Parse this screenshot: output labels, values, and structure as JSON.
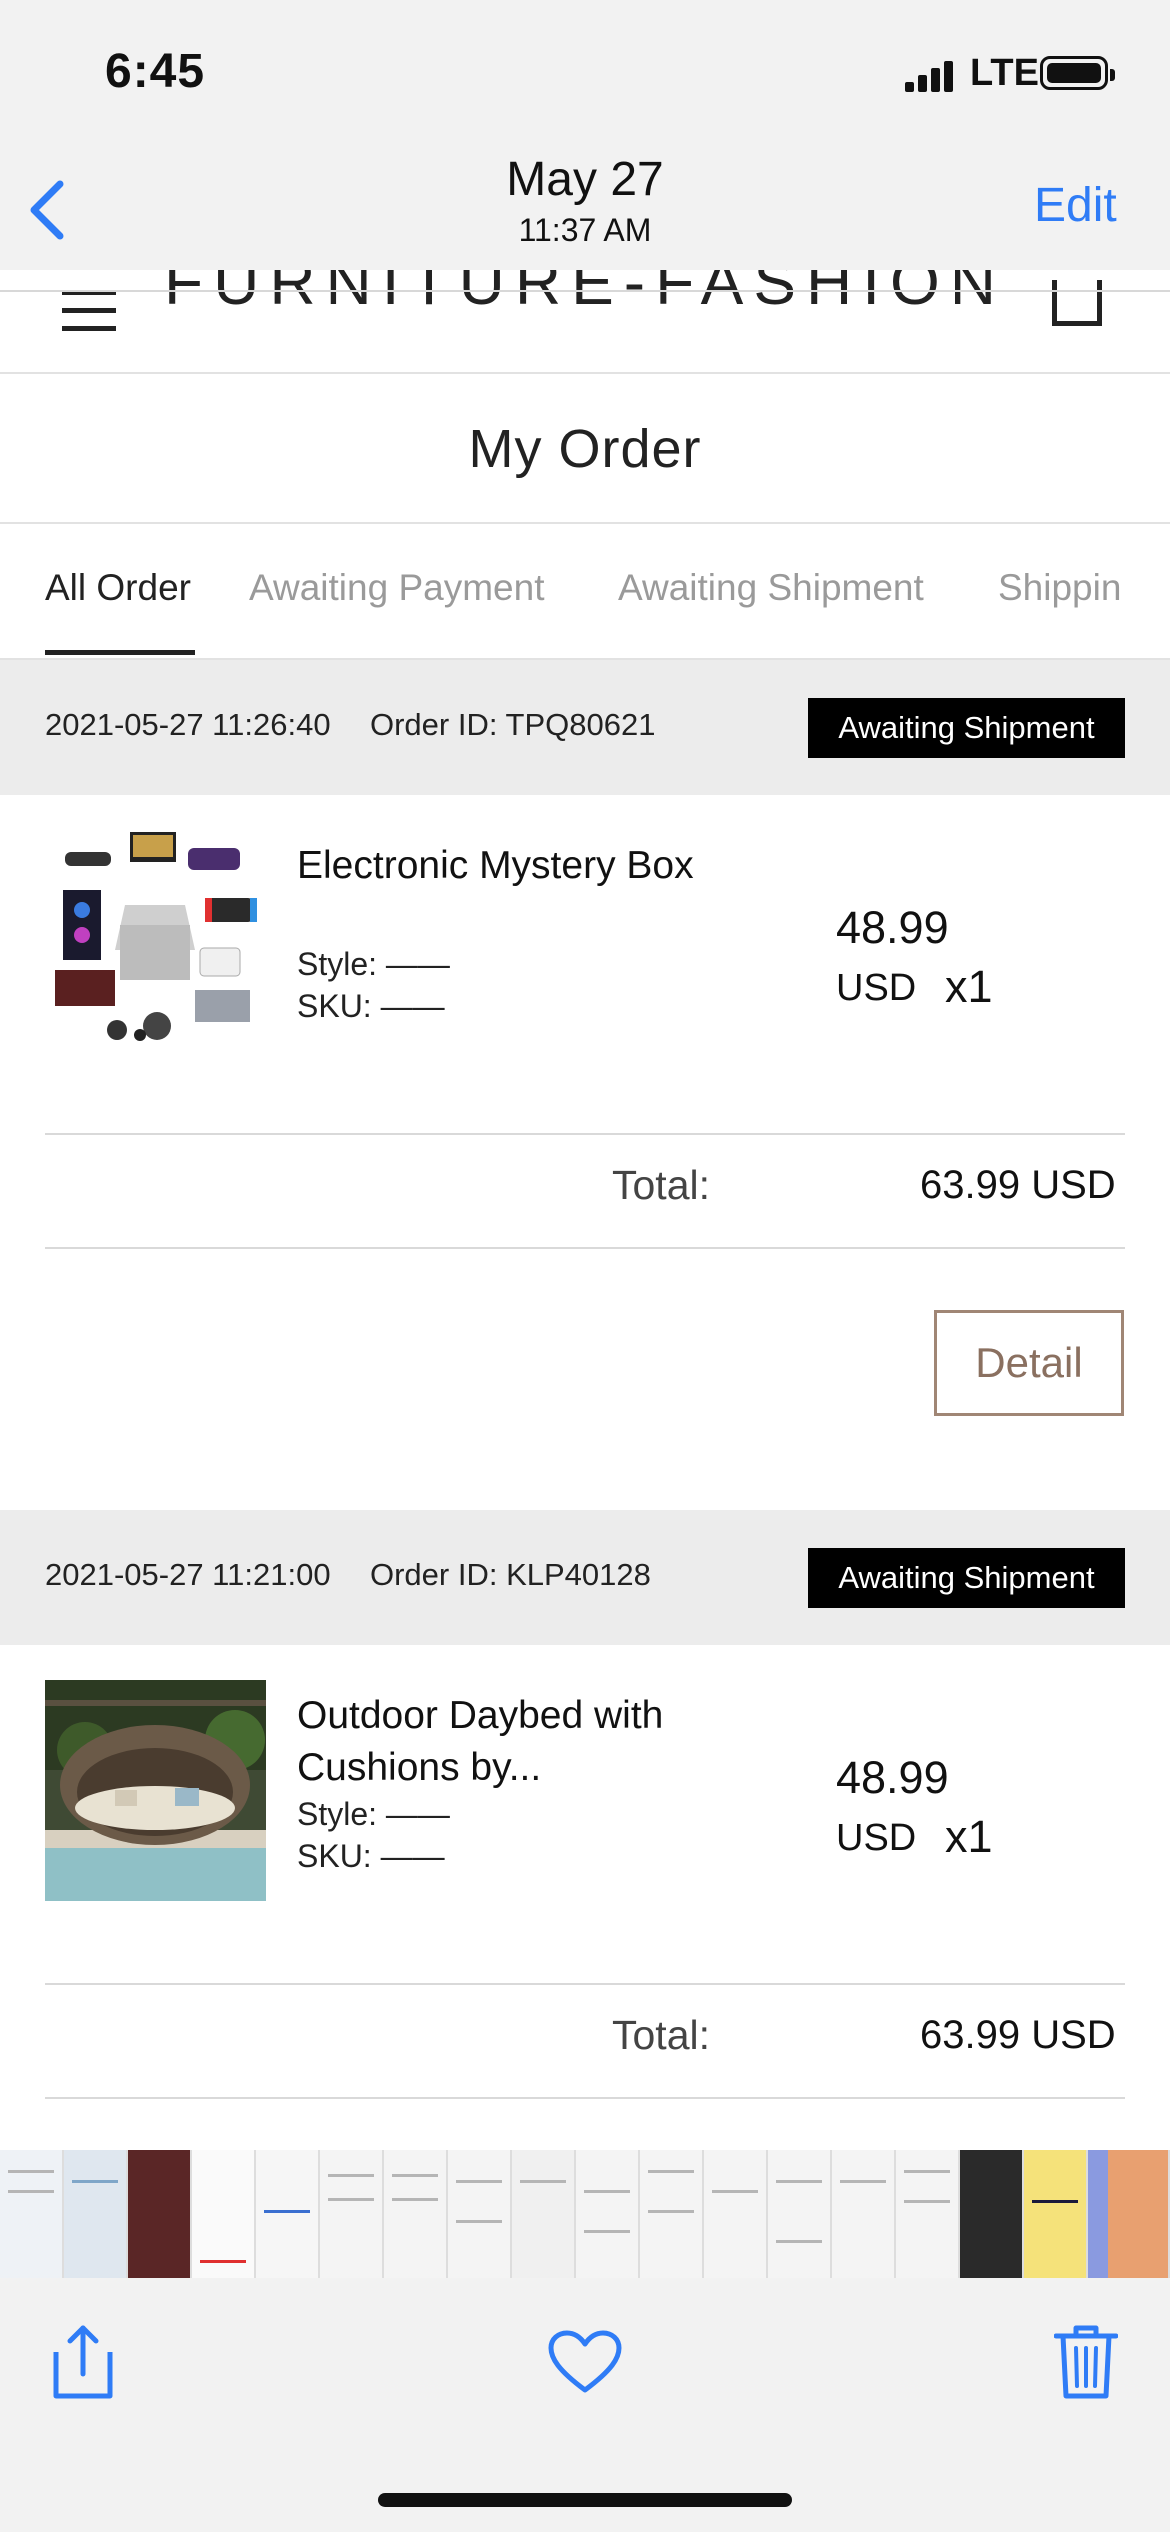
{
  "status_bar": {
    "time": "6:45",
    "network": "LTE"
  },
  "photo_nav": {
    "date": "May 27",
    "time": "11:37 AM",
    "edit_label": "Edit"
  },
  "site": {
    "brand": "FURNITURE-FASHION",
    "page_title": "My Order"
  },
  "tabs": [
    {
      "label": "All Order",
      "active": true
    },
    {
      "label": "Awaiting Payment",
      "active": false
    },
    {
      "label": "Awaiting Shipment",
      "active": false
    },
    {
      "label": "Shippin",
      "active": false
    }
  ],
  "orders": [
    {
      "datetime": "2021-05-27 11:26:40",
      "order_id": "Order ID: TPQ80621",
      "status": "Awaiting Shipment",
      "product_name": "Electronic Mystery Box",
      "style": "Style: ——",
      "sku": "SKU: ——",
      "price": "48.99",
      "currency": "USD",
      "qty": "x1",
      "total_label": "Total:",
      "total_value": "63.99 USD",
      "detail_label": "Detail"
    },
    {
      "datetime": "2021-05-27 11:21:00",
      "order_id": "Order ID: KLP40128",
      "status": "Awaiting Shipment",
      "product_name": "Outdoor Daybed with Cushions by...",
      "style": "Style: ——",
      "sku": "SKU: ——",
      "price": "48.99",
      "currency": "USD",
      "qty": "x1",
      "total_label": "Total:",
      "total_value": "63.99 USD"
    }
  ],
  "toolbar": {
    "share_icon": "share-icon",
    "favorite_icon": "heart-icon",
    "delete_icon": "trash-icon"
  },
  "colors": {
    "accent": "#2f7cf6",
    "badge": "#000000",
    "detail_border": "#a08675"
  }
}
